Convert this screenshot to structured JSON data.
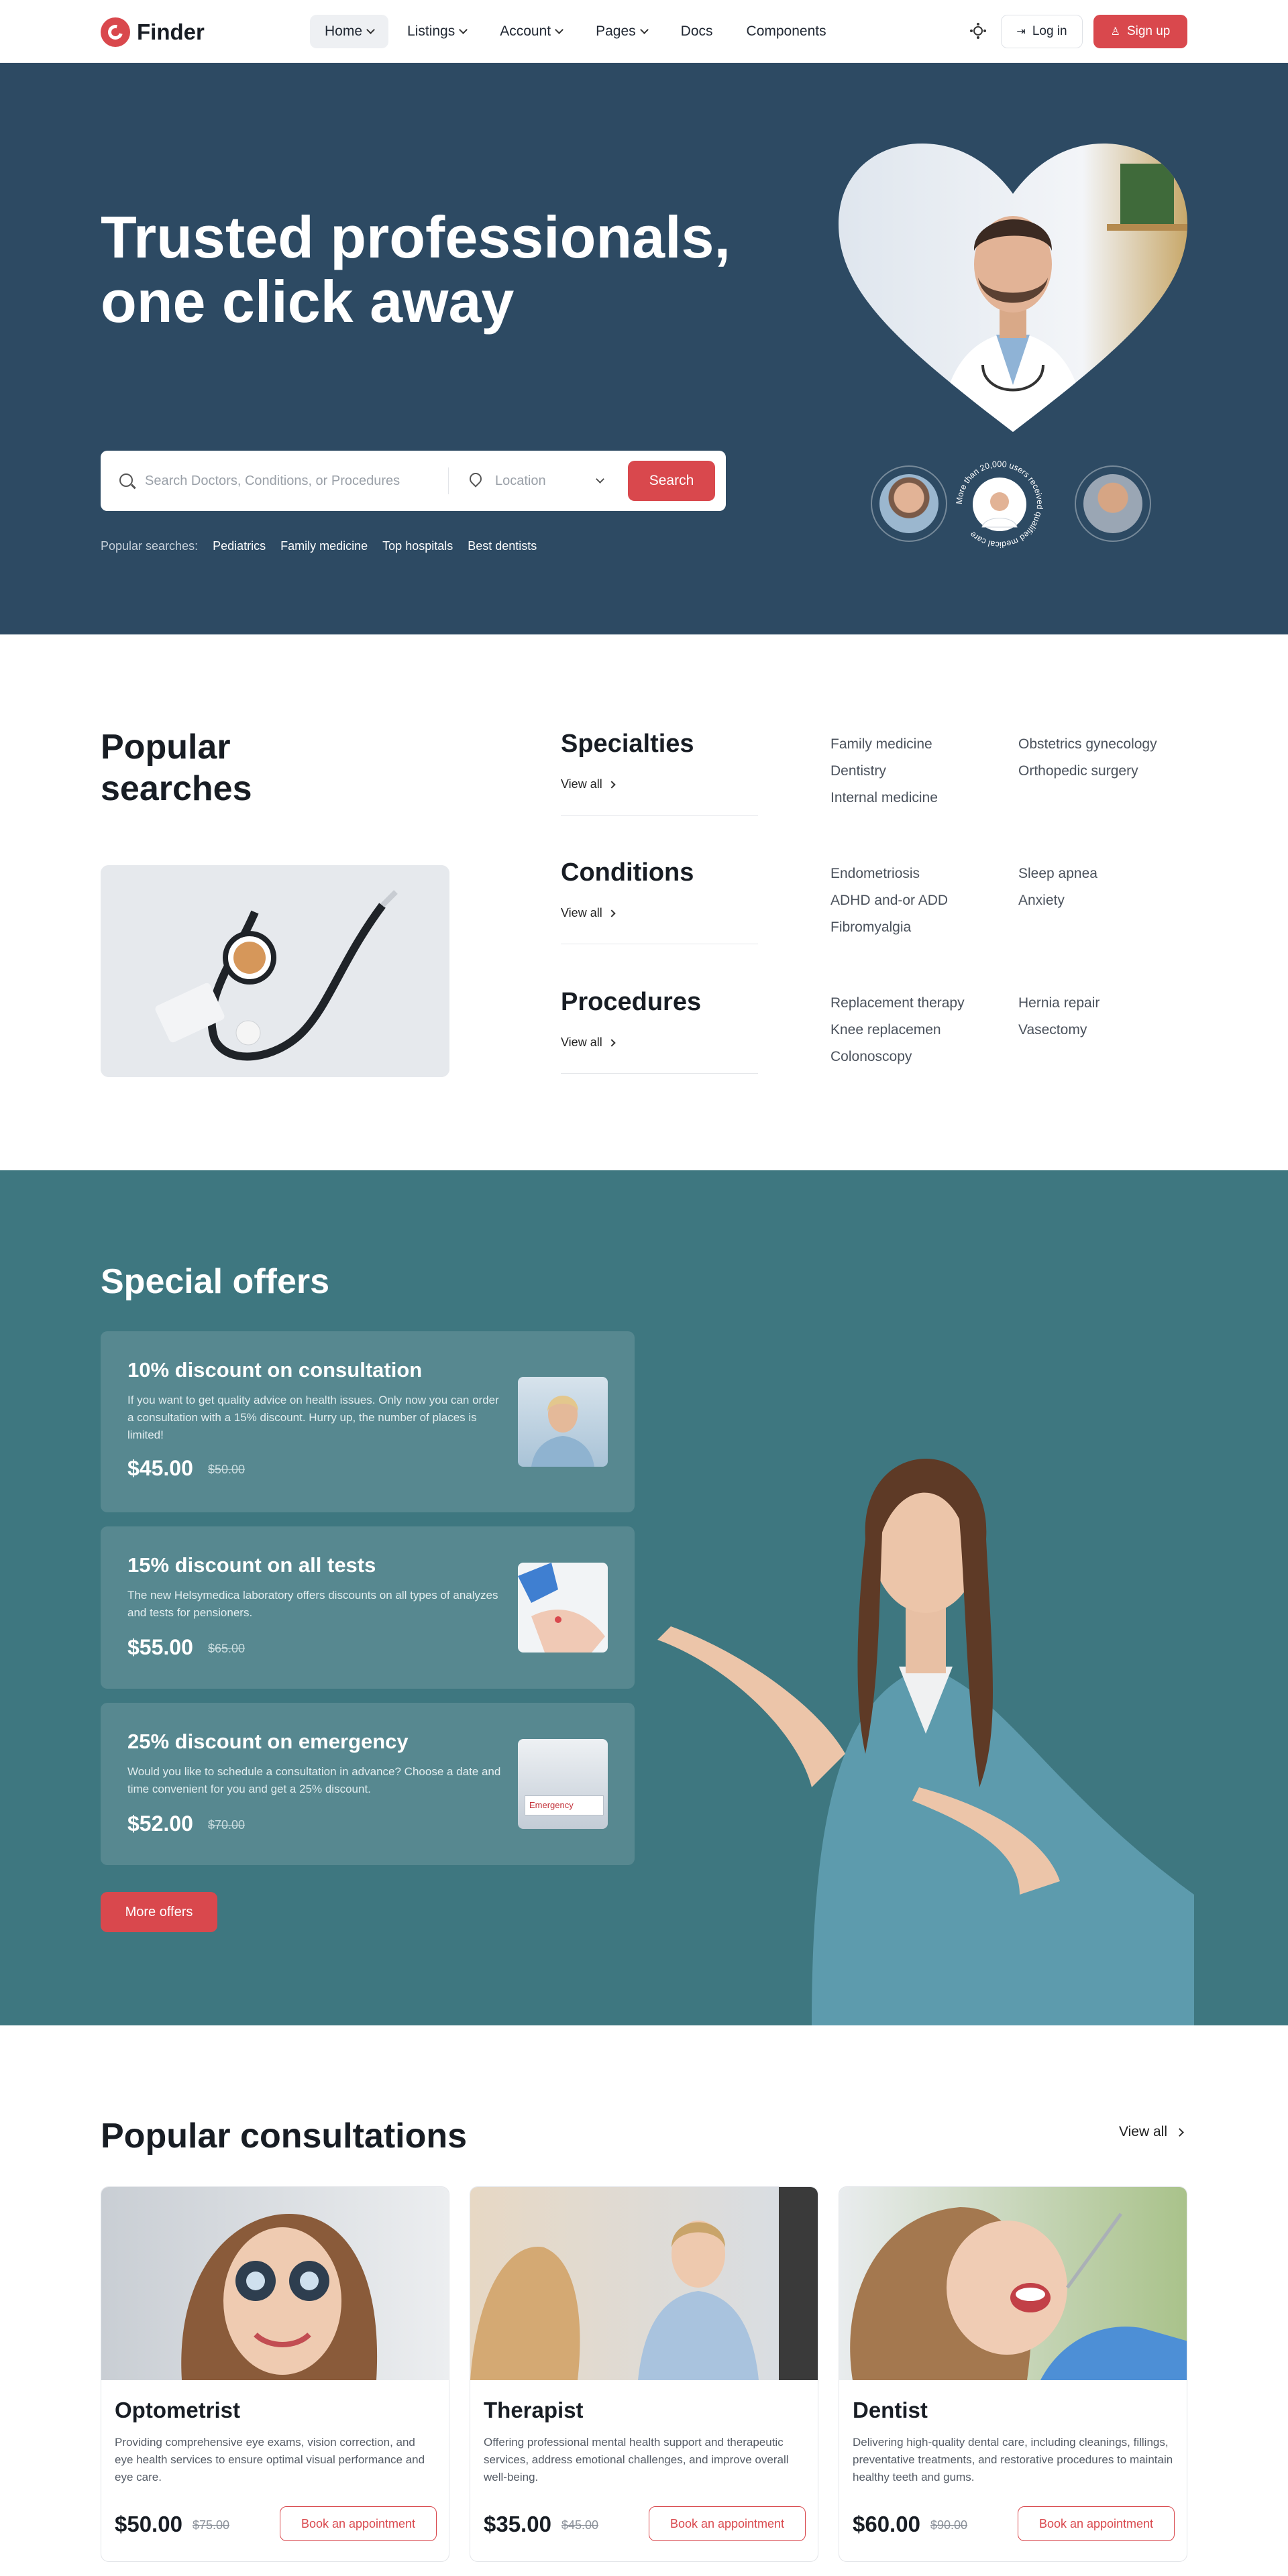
{
  "nav": {
    "logo_text": "Finder",
    "items": [
      {
        "label": "Home",
        "has_dropdown": true,
        "active": true
      },
      {
        "label": "Listings",
        "has_dropdown": true
      },
      {
        "label": "Account",
        "has_dropdown": true
      },
      {
        "label": "Pages",
        "has_dropdown": true
      },
      {
        "label": "Docs",
        "has_dropdown": false
      },
      {
        "label": "Components",
        "has_dropdown": false
      }
    ],
    "theme_icon": "sun-icon",
    "login_label": "Log in",
    "signup_label": "Sign up"
  },
  "hero": {
    "title_line1": "Trusted professionals,",
    "title_line2": "one click away",
    "search_placeholder": "Search Doctors, Conditions, or Procedures",
    "location_placeholder": "Location",
    "search_button": "Search",
    "popular_label": "Popular searches:",
    "popular_links": [
      "Pediatrics",
      "Family medicine",
      "Top hospitals",
      "Best dentists"
    ],
    "ring_text": "More than 20,000 users received qualified medical care"
  },
  "popular_searches": {
    "title": "Popular searches",
    "categories": [
      {
        "title": "Specialties",
        "view_all": "View all",
        "items": [
          "Family medicine",
          "Obstetrics gynecology",
          "Dentistry",
          "Orthopedic surgery",
          "Internal medicine"
        ]
      },
      {
        "title": "Conditions",
        "view_all": "View all",
        "items": [
          "Endometriosis",
          "Sleep apnea",
          "ADHD and-or ADD",
          "Anxiety",
          "Fibromyalgia"
        ]
      },
      {
        "title": "Procedures",
        "view_all": "View all",
        "items": [
          "Replacement therapy",
          "Hernia repair",
          "Knee replacemen",
          "Vasectomy",
          "Colonoscopy"
        ]
      }
    ]
  },
  "offers": {
    "title": "Special offers",
    "cards": [
      {
        "title": "10% discount on consultation",
        "text": "If you want to get quality advice on health issues. Only now you can order a consultation with a 15% discount. Hurry up, the number of places is limited!",
        "price": "$45.00",
        "old_price": "$50.00"
      },
      {
        "title": "15% discount on all tests",
        "text": "The new Helsymedica laboratory offers discounts on all types of analyzes and tests for pensioners.",
        "price": "$55.00",
        "old_price": "$65.00"
      },
      {
        "title": "25% discount on emergency",
        "text": "Would you like to schedule a consultation in advance? Choose a date and time convenient for you and get a 25% discount.",
        "price": "$52.00",
        "old_price": "$70.00",
        "thumb_sign": "Emergency"
      }
    ],
    "more_button": "More offers"
  },
  "consultations": {
    "title": "Popular consultations",
    "view_all": "View all",
    "cards": [
      {
        "name": "Optometrist",
        "desc": "Providing comprehensive eye exams, vision correction, and eye health services to ensure optimal visual performance and eye care.",
        "price": "$50.00",
        "old_price": "$75.00",
        "button": "Book an appointment"
      },
      {
        "name": "Therapist",
        "desc": "Offering professional mental health support and therapeutic services, address emotional challenges, and improve overall well-being.",
        "price": "$35.00",
        "old_price": "$45.00",
        "button": "Book an appointment"
      },
      {
        "name": "Dentist",
        "desc": "Delivering high-quality dental care, including cleanings, fillings, preventative treatments, and restorative procedures to maintain healthy teeth and gums.",
        "price": "$60.00",
        "old_price": "$90.00",
        "button": "Book an appointment"
      }
    ]
  },
  "colors": {
    "accent": "#d9484d",
    "hero_bg": "#2d4a63",
    "offers_bg": "#3e7780"
  }
}
